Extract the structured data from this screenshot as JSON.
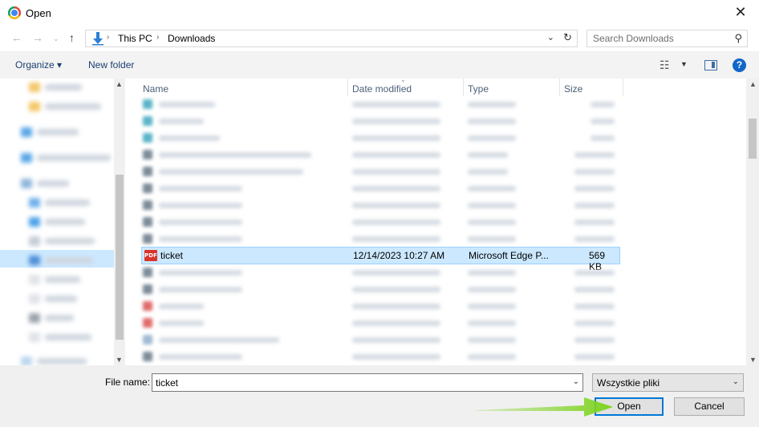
{
  "window": {
    "title": "Open"
  },
  "address": {
    "crumbs": [
      "This PC",
      "Downloads"
    ]
  },
  "search": {
    "placeholder": "Search Downloads"
  },
  "toolbar": {
    "organize_label": "Organize ▾",
    "new_folder_label": "New folder"
  },
  "columns": {
    "name": "Name",
    "date_modified": "Date modified",
    "type": "Type",
    "size": "Size"
  },
  "selected_file": {
    "name": "ticket",
    "date_modified": "12/14/2023 10:27 AM",
    "type": "Microsoft Edge P...",
    "size": "569 KB",
    "icon_label": "PDF"
  },
  "file_name": {
    "label": "File name:",
    "value": "ticket"
  },
  "file_type": {
    "selected": "Wszystkie pliki"
  },
  "buttons": {
    "open": "Open",
    "cancel": "Cancel"
  },
  "colors": {
    "selection": "#cce8ff",
    "accent": "#0078d7",
    "arrow": "#7ed321"
  }
}
